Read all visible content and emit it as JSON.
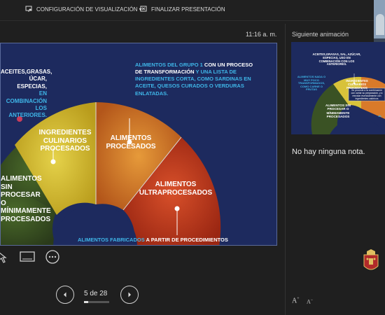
{
  "toolbar": {
    "config_label": "CONFIGURACIÓN DE VISUALIZACIÓN ▾",
    "end_label": "FINALIZAR PRESENTACIÓN"
  },
  "webcam": {
    "label": "AR"
  },
  "clock": "11:16 a. m.",
  "slide": {
    "top_left_lines": [
      "ACEITES,GRASAS,",
      "ÚCAR, ESPECIAS,",
      "EN COMBINACIÓN",
      "LOS ANTERIORES."
    ],
    "top_right_part1": "ALIMENTOS DEL GRUPO 1",
    "top_right_part2": "CON UN PROCESO DE TRANSFORMACIÓN",
    "top_right_part3": "Y UNA LISTA DE INGREDIENTES CORTA, COMO SARDINAS EN ACEITE, QUESOS CURADOS O VERDURAS ENLATADAS.",
    "seg_ingredientes": "INGREDIENTES CULINARIOS PROCESADOS",
    "seg_procesados": "ALIMENTOS PROCESADOS",
    "seg_ultra": "ALIMENTOS ULTRAPROCESADOS",
    "seg_sin_lines": [
      "ALIMENTOS SIN",
      "PROCESAR",
      "O MÍNIMAMENTE",
      "PROCESADOS"
    ],
    "bottom_part1": "ALIMENTOS FABRICADOS",
    "bottom_part2": "A PARTIR DE PROCEDIMIENTOS"
  },
  "sidebar": {
    "next_label": "Siguiente animación",
    "notes_text": "No hay ninguna nota."
  },
  "thumbnail": {
    "top_text": "ACEITES,GRASAS, SAL, AZÚCAR, ESPECIAS, USO EN COMBINACIÓN CON LOS ANTERIORES.",
    "left_text": "ALIMENTOS NADA O MUY POCO TRANSFORMADOS, COMO CARNE O FRUTAS",
    "mid_text": "INGREDIENTES CULINARIOS PROCESADOS",
    "sin_text": "ALIMENTOS SIN PROCESAR O MÍNIMAMENTE PROCESADOS",
    "box_text": "Se procede a la combinación con cortar su preparación, y a mezclar esencialmente con ingredientes calóricos",
    "right_text": "AL"
  },
  "navigation": {
    "counter": "5 de 28",
    "progress": 0.18
  },
  "icons": {
    "display": "display-settings-icon",
    "end": "end-presentation-icon",
    "pointer": "pointer-icon",
    "screen": "screen-icon",
    "more": "more-options-icon"
  },
  "font_controls": {
    "increase": "A",
    "decrease": "A"
  },
  "colors": {
    "slide_bg": "#1d2a5e",
    "accent_cyan": "#3fb6e8",
    "segment_yellow": "#d8c23a",
    "segment_orange": "#d97a2a",
    "segment_red": "#c8341c"
  }
}
